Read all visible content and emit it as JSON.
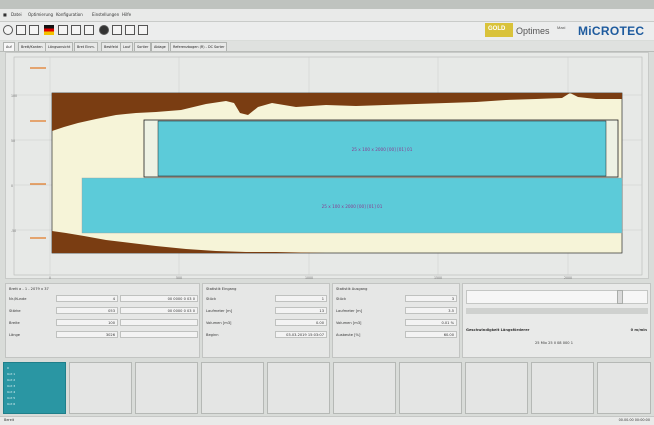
{
  "menu": {
    "items": [
      "Datei",
      "Optimierung",
      "Konfiguration",
      "Einstellungen",
      "Hilfe"
    ]
  },
  "brand": {
    "product_prefix": "GOLD",
    "product": "Optimes",
    "edition": "Maxi",
    "company": "MiCROTEC"
  },
  "tabs": [
    "Auf",
    "Brett/Kanten",
    "Längsansicht",
    "Bret Einm.",
    "Bestfeld",
    "Lauf",
    "Sortier",
    "Ablage",
    "Referenzbogen (R) - DC Sorter"
  ],
  "colors": {
    "wood_brown": "#7a3d12",
    "cream": "#f6f4d8",
    "board_cyan": "#5ccbd9",
    "text_purple": "#8a3b8f",
    "accent_orange": "#e2761f",
    "thumb_active": "#2a96a3"
  },
  "plot": {
    "board_upper_label": "25 x 100 x 2000 [00] [01] 01",
    "board_lower_label": "25 x 100 x 2000 [00] [01] 01",
    "y_ticks": [
      "100",
      "50",
      "0",
      "-50"
    ],
    "x_ticks": [
      "0",
      "500",
      "1000",
      "1500",
      "2000"
    ]
  },
  "left_panel": {
    "header": "Brett a - 1 - 2079 x 37",
    "rows": [
      {
        "label": "Nr./Kunde",
        "num": "4",
        "value": "00 0000 0 03 0"
      },
      {
        "label": "Stärke",
        "num": "053",
        "value": "00 0000 0 03 0"
      },
      {
        "label": "Breite",
        "num": "100",
        "value": ""
      },
      {
        "label": "Länge",
        "num": "3026",
        "value": ""
      }
    ]
  },
  "mid_panel": {
    "header": "Statistik Eingang",
    "rows": [
      {
        "label": "Stück",
        "value": "1"
      },
      {
        "label": "Laufmeter [m]",
        "value": "13"
      },
      {
        "label": "Volumen [m3]",
        "value": "0.00"
      },
      {
        "label": "Beginn",
        "value": "03.03.2019 15:03:07"
      }
    ]
  },
  "right_panel": {
    "header": "Statistik Ausgang",
    "rows": [
      {
        "label": "Stück",
        "value": "3"
      },
      {
        "label": "Laufmeter [m]",
        "value": "3.5"
      },
      {
        "label": "Volumen [m3]",
        "value": "0.01 %"
      },
      {
        "label": "Ausbeute [%]",
        "value": "60.00"
      }
    ]
  },
  "speed_panel": {
    "label": "Geschwindigkeit Längsförderer",
    "value": "0 m/min",
    "sub": "25 Mix 25 Il 08 000 1"
  },
  "thumbs": {
    "active_lines": [
      "0",
      "Unt 1",
      "Unt 2",
      "Unt 3",
      "Unt 4",
      "Unt 5",
      "Unt 6"
    ]
  },
  "status": {
    "left": "Bereit",
    "right": "00.00.00 00:00:00"
  }
}
